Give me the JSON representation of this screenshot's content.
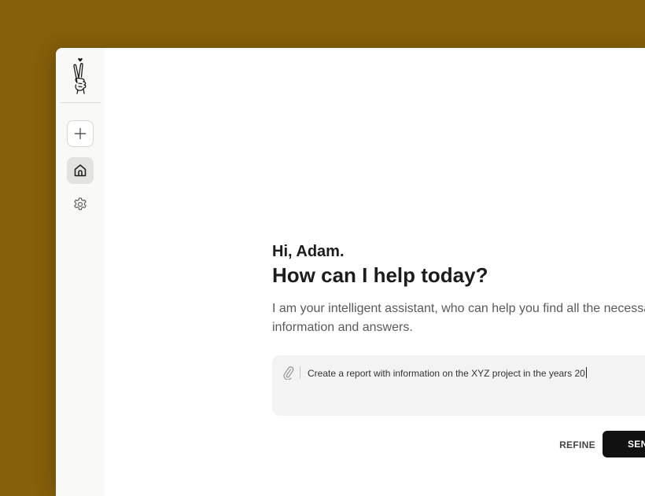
{
  "sidebar": {
    "logo_icon": "peace-hand-heart-icon",
    "items": [
      {
        "name": "new-chat",
        "icon": "plus-icon"
      },
      {
        "name": "home",
        "icon": "home-icon",
        "active": true
      },
      {
        "name": "settings",
        "icon": "gear-icon"
      }
    ]
  },
  "main": {
    "greeting": "Hi, Adam.",
    "headline": "How can I help today?",
    "description": "I am your intelligent assistant, who can help you find all the necessary information and answers.",
    "prompt": {
      "value": "Create a report with information on the XYZ project in the years 20",
      "attach_icon": "paperclip-icon"
    },
    "actions": {
      "refine_label": "REFINE",
      "send_label": "SEND"
    }
  },
  "colors": {
    "backdrop": "#86600a",
    "sidebar_bg": "#f9f9f7",
    "active_item_bg": "#e3e3df",
    "input_bg": "#f3f3f3",
    "send_bg": "#111111"
  }
}
